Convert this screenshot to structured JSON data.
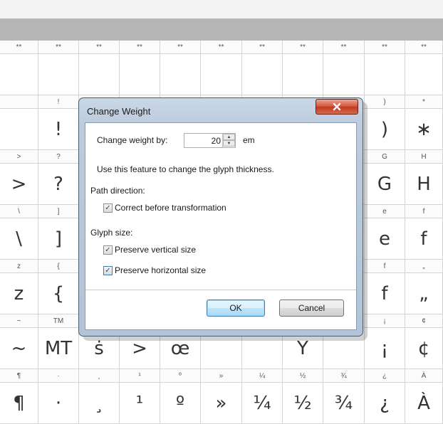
{
  "grid": {
    "rows": [
      {
        "kind": "hdr",
        "cells": [
          "**",
          "**",
          "**",
          "**",
          "**",
          "**",
          "**",
          "**",
          "**",
          "**",
          "**"
        ]
      },
      {
        "kind": "gly",
        "cells": [
          "",
          "",
          "",
          "",
          "",
          "",
          "",
          "",
          "",
          "",
          ""
        ]
      },
      {
        "kind": "hdr",
        "cells": [
          "",
          "!",
          "",
          "",
          "",
          "",
          "",
          "",
          "",
          ")",
          "*"
        ]
      },
      {
        "kind": "gly",
        "cells": [
          "",
          "!",
          "",
          "",
          "",
          "",
          "",
          "",
          "",
          ")",
          "∗"
        ]
      },
      {
        "kind": "hdr",
        "cells": [
          ">",
          "?",
          "",
          "",
          "",
          "",
          "",
          "",
          "",
          "G",
          "H"
        ]
      },
      {
        "kind": "gly",
        "cells": [
          ">",
          "?",
          "",
          "",
          "",
          "",
          "",
          "",
          "",
          "G",
          "H"
        ]
      },
      {
        "kind": "hdr",
        "cells": [
          "\\",
          "]",
          "",
          "",
          "",
          "",
          "",
          "",
          "",
          "e",
          "f"
        ]
      },
      {
        "kind": "gly",
        "cells": [
          "\\",
          "]",
          "",
          "",
          "",
          "",
          "",
          "",
          "",
          "e",
          "f"
        ]
      },
      {
        "kind": "hdr",
        "cells": [
          "z",
          "{",
          "",
          "",
          "",
          "",
          "",
          "",
          "",
          "f",
          "„"
        ]
      },
      {
        "kind": "gly",
        "cells": [
          "z",
          "{",
          "",
          "",
          "",
          "",
          "",
          "",
          "",
          "f",
          "„"
        ]
      },
      {
        "kind": "hdr",
        "cells": [
          "~",
          "TM",
          "",
          "",
          "",
          "",
          "",
          "",
          "",
          "¡",
          "¢"
        ]
      },
      {
        "kind": "gly",
        "cells": [
          "~",
          "MT",
          "ṡ",
          ">",
          "œ",
          "",
          "",
          "Y",
          "",
          "¡",
          "¢"
        ]
      },
      {
        "kind": "hdr",
        "cells": [
          "¶",
          "·",
          "¸",
          "¹",
          "º",
          "»",
          "¼",
          "½",
          "¾",
          "¿",
          "À"
        ]
      },
      {
        "kind": "gly",
        "cells": [
          "¶",
          "·",
          "¸",
          "¹",
          "º",
          "»",
          "¼",
          "½",
          "¾",
          "¿",
          "À"
        ]
      }
    ]
  },
  "dialog": {
    "title": "Change Weight",
    "close_glyph": "x",
    "weight_label": "Change weight by:",
    "weight_value": "20",
    "weight_unit": "em",
    "description": "Use this feature to change the glyph thickness.",
    "path_direction_label": "Path direction:",
    "correct_label": "Correct before transformation",
    "glyph_size_label": "Glyph size:",
    "vertical_label": "Preserve vertical size",
    "horizontal_label": "Preserve horizontal size",
    "check_glyph": "✓",
    "spin_up_glyph": "▲",
    "spin_down_glyph": "▼",
    "ok_label": "OK",
    "cancel_label": "Cancel"
  }
}
